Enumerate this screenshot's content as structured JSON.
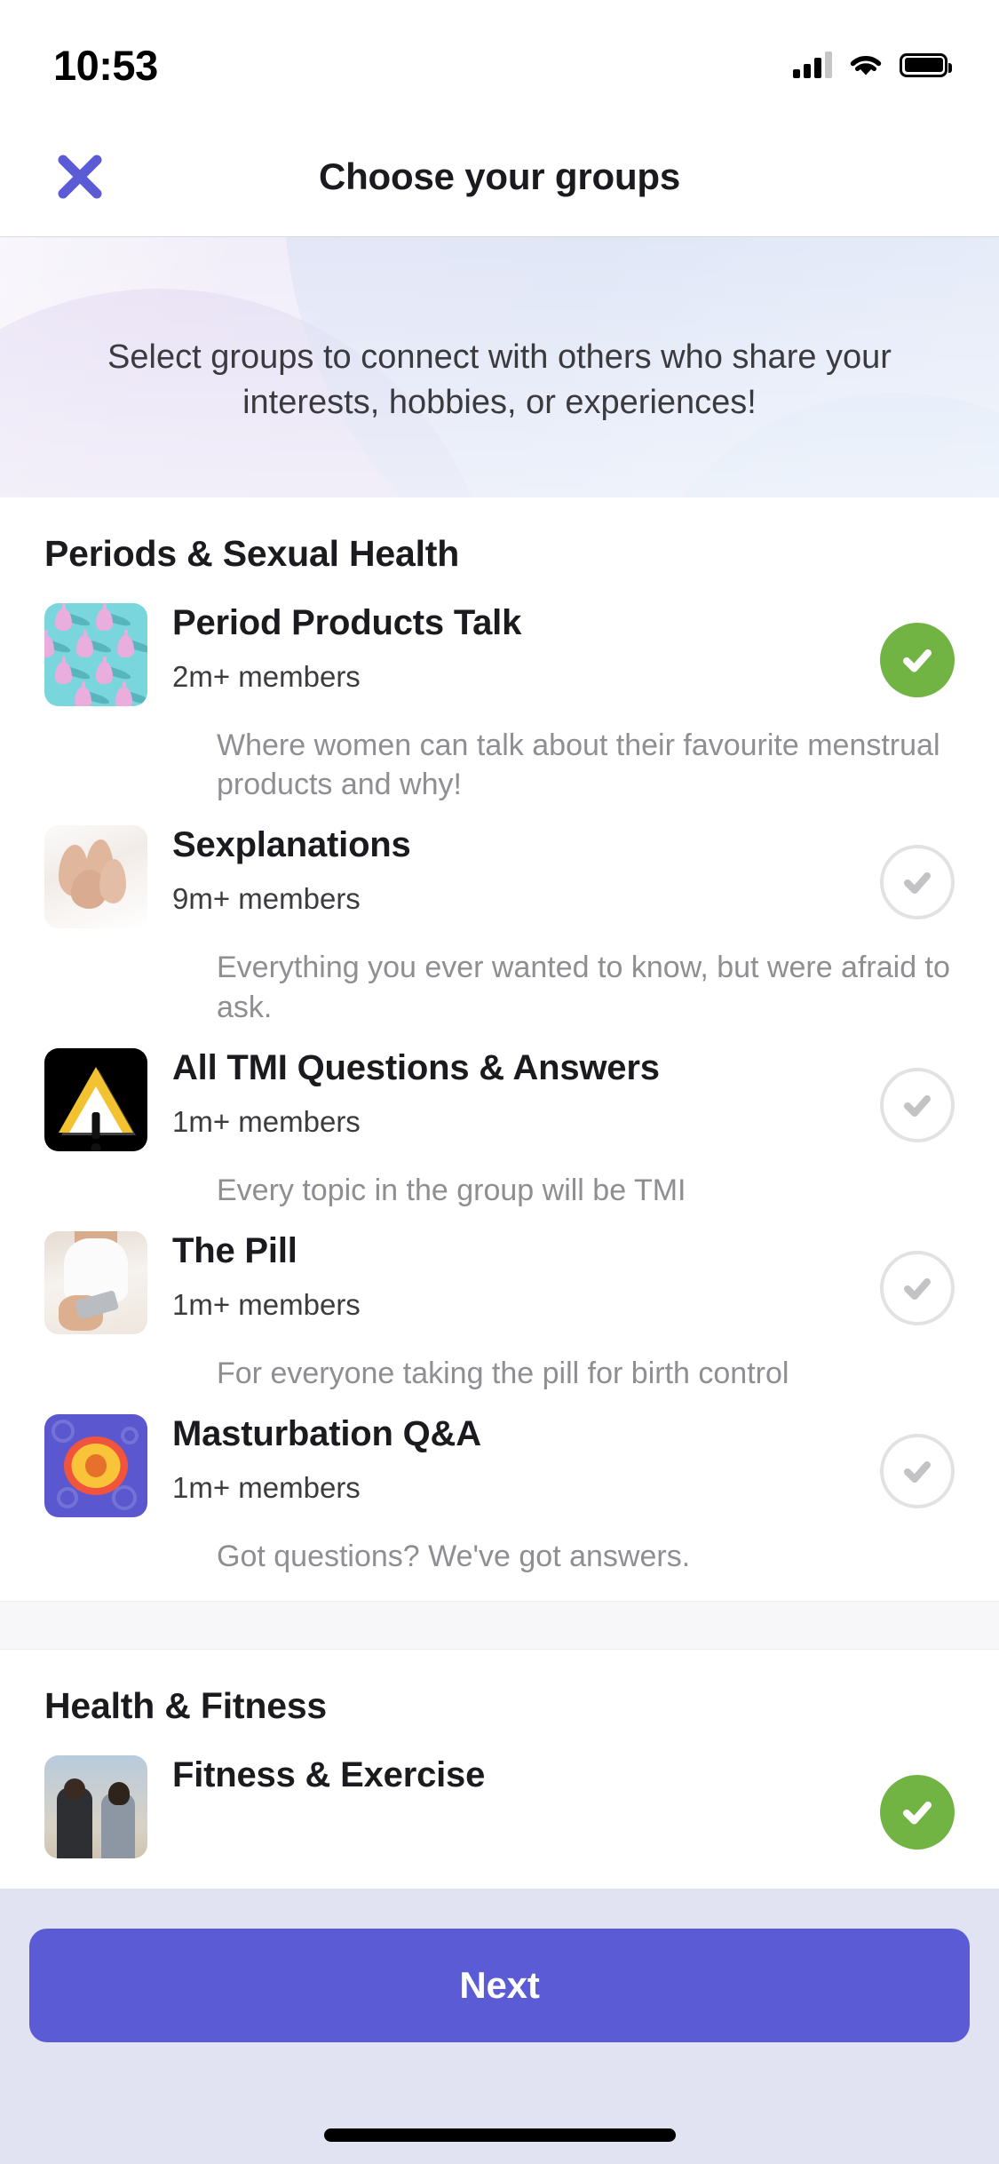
{
  "status_bar": {
    "time": "10:53",
    "cellular_icon": "signal-bars-icon",
    "wifi_icon": "wifi-icon",
    "battery_icon": "battery-full-icon"
  },
  "header": {
    "close_icon": "close-x-icon",
    "title": "Choose your groups"
  },
  "banner": {
    "text": "Select groups to connect with others who share your interests, hobbies, or experiences!"
  },
  "sections": [
    {
      "title": "Periods & Sexual Health",
      "groups": [
        {
          "name": "Period Products Talk",
          "members": "2m+ members",
          "description": "Where women can talk about their favourite menstrual products and why!",
          "selected": true,
          "thumbnail": "menstrual-cups-pattern-thumbnail"
        },
        {
          "name": "Sexplanations",
          "members": "9m+ members",
          "description": "Everything you ever wanted to know, but were afraid to ask.",
          "selected": false,
          "thumbnail": "feet-in-bed-thumbnail"
        },
        {
          "name": "All TMI Questions & Answers",
          "members": "1m+ members",
          "description": "Every topic in the group will be TMI",
          "selected": false,
          "thumbnail": "warning-triangle-thumbnail"
        },
        {
          "name": "The Pill",
          "members": "1m+ members",
          "description": "For everyone taking the pill for birth control",
          "selected": false,
          "thumbnail": "woman-holding-pill-pack-thumbnail"
        },
        {
          "name": "Masturbation Q&A",
          "members": "1m+ members",
          "description": "Got questions? We've got answers.",
          "selected": false,
          "thumbnail": "peach-on-purple-thumbnail"
        }
      ]
    },
    {
      "title": "Health & Fitness",
      "groups": [
        {
          "name": "Fitness & Exercise",
          "members": "",
          "description": "",
          "selected": true,
          "thumbnail": "couple-exercising-thumbnail"
        }
      ]
    }
  ],
  "bottom_bar": {
    "next_label": "Next"
  },
  "colors": {
    "accent_purple": "#5b5bd6",
    "selected_green": "#71b443",
    "unselected_gray": "#e2e2e4",
    "bottom_bar_bg": "#e2e3f2"
  }
}
